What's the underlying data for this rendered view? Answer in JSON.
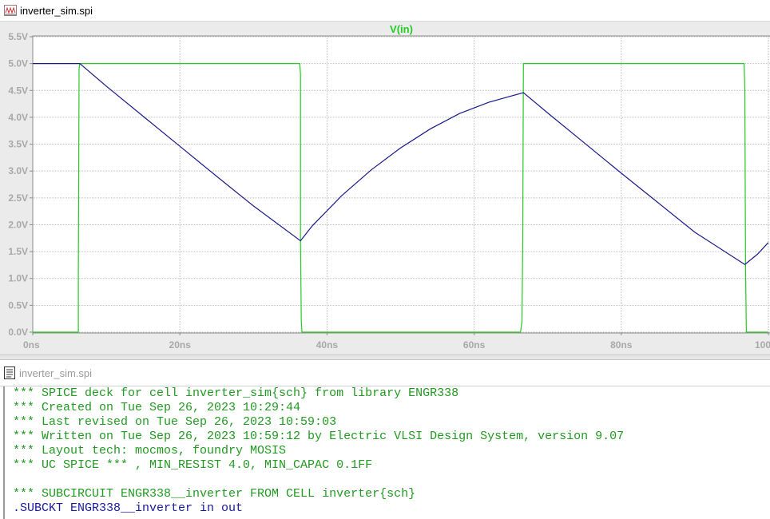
{
  "plot_window": {
    "title": "inverter_sim.spi",
    "icon": "waveform-icon"
  },
  "netlist_window": {
    "title": "inverter_sim.spi",
    "icon": "document-icon",
    "lines": [
      {
        "text": "*** SPICE deck for cell inverter_sim{sch} from library ENGR338",
        "kind": "comment"
      },
      {
        "text": "*** Created on Tue Sep 26, 2023 10:29:44",
        "kind": "comment"
      },
      {
        "text": "*** Last revised on Tue Sep 26, 2023 10:59:03",
        "kind": "comment"
      },
      {
        "text": "*** Written on Tue Sep 26, 2023 10:59:12 by Electric VLSI Design System, version 9.07",
        "kind": "comment"
      },
      {
        "text": "*** Layout tech: mocmos, foundry MOSIS",
        "kind": "comment"
      },
      {
        "text": "*** UC SPICE *** , MIN_RESIST 4.0, MIN_CAPAC 0.1FF",
        "kind": "comment"
      },
      {
        "text": "",
        "kind": "blank"
      },
      {
        "text": "*** SUBCIRCUIT ENGR338__inverter FROM CELL inverter{sch}",
        "kind": "comment"
      },
      {
        "text": ".SUBCKT ENGR338__inverter in out",
        "kind": "code"
      }
    ]
  },
  "colors": {
    "plot_background": "#ffffff",
    "pane_background": "#ebebeb",
    "grid": "#c0c0c0",
    "axis_label": "#a8a8a8",
    "vin_trace": "#22cc22",
    "second_trace": "#1a1a8c",
    "comment_text": "#229922",
    "code_text": "#1a1a9a"
  },
  "chart_data": {
    "type": "line",
    "title": "",
    "xlabel": "",
    "ylabel": "",
    "xlim": [
      0,
      100
    ],
    "ylim": [
      0,
      5.5
    ],
    "x_unit": "ns",
    "grid": true,
    "x_ticks": [
      {
        "value": 0,
        "label": "0ns"
      },
      {
        "value": 20,
        "label": "20ns"
      },
      {
        "value": 40,
        "label": "40ns"
      },
      {
        "value": 60,
        "label": "60ns"
      },
      {
        "value": 80,
        "label": "80ns"
      },
      {
        "value": 100,
        "label": "100ns"
      }
    ],
    "y_ticks": [
      {
        "value": 0.0,
        "label": "0.0V"
      },
      {
        "value": 0.5,
        "label": "0.5V"
      },
      {
        "value": 1.0,
        "label": "1.0V"
      },
      {
        "value": 1.5,
        "label": "1.5V"
      },
      {
        "value": 2.0,
        "label": "2.0V"
      },
      {
        "value": 2.5,
        "label": "2.5V"
      },
      {
        "value": 3.0,
        "label": "3.0V"
      },
      {
        "value": 3.5,
        "label": "3.5V"
      },
      {
        "value": 4.0,
        "label": "4.0V"
      },
      {
        "value": 4.5,
        "label": "4.5V"
      },
      {
        "value": 5.0,
        "label": "5.0V"
      },
      {
        "value": 5.5,
        "label": "5.5V"
      }
    ],
    "legend_position": "top-center",
    "series": [
      {
        "name": "V(in)",
        "color": "#22cc22",
        "x": [
          0,
          6.2,
          6.2,
          6.3,
          6.4,
          36.3,
          36.4,
          36.4,
          36.5,
          36.6,
          66.3,
          66.5,
          66.6,
          66.7,
          96.7,
          96.8,
          96.9,
          97.0,
          100
        ],
        "y": [
          0,
          0,
          1.1,
          4.9,
          5.0,
          5.0,
          4.8,
          1.7,
          0.2,
          0,
          0,
          0.2,
          1.6,
          5.0,
          5.0,
          4.5,
          1.2,
          0,
          0
        ]
      },
      {
        "name": "",
        "color": "#1a1a8c",
        "x": [
          0,
          6.4,
          10,
          15,
          20,
          25,
          30,
          36.4,
          38,
          42,
          46,
          50,
          54,
          58,
          62,
          66.7,
          70,
          75,
          80,
          85,
          90,
          96.8,
          98.5,
          100
        ],
        "y": [
          5.0,
          5.0,
          4.58,
          4.02,
          3.46,
          2.9,
          2.35,
          1.7,
          1.98,
          2.54,
          3.02,
          3.43,
          3.78,
          4.07,
          4.28,
          4.46,
          4.08,
          3.52,
          2.96,
          2.41,
          1.86,
          1.26,
          1.45,
          1.67
        ]
      }
    ]
  }
}
